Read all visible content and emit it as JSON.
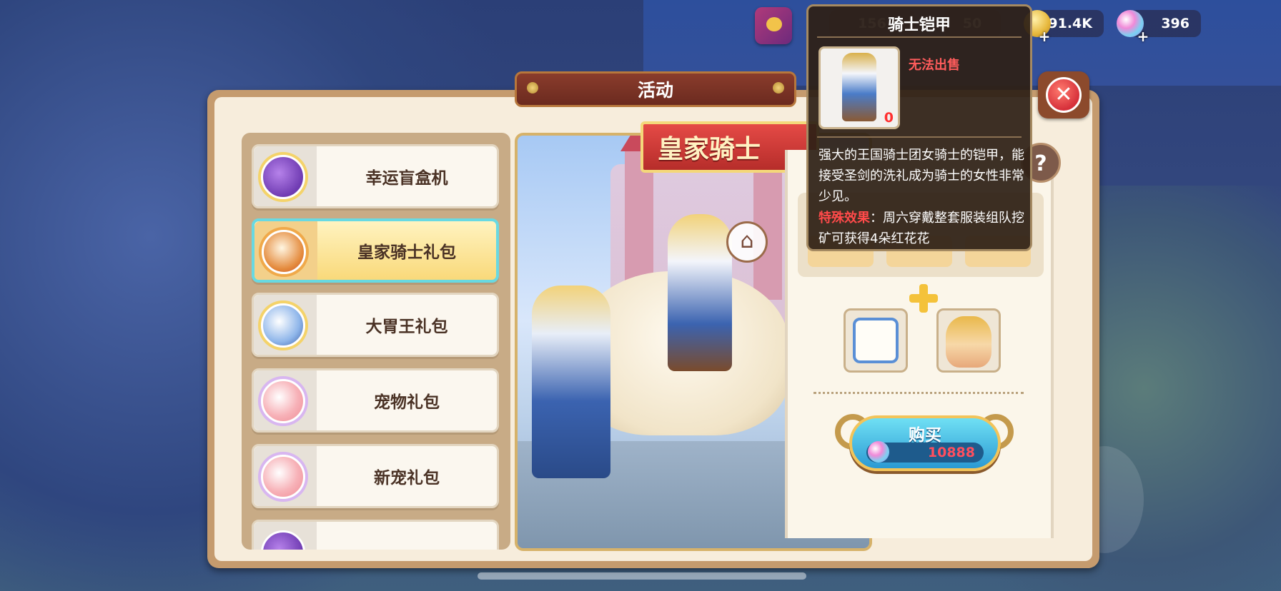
{
  "header": {
    "title": "活动",
    "close_icon": "close-icon"
  },
  "resources": {
    "stat_a": "156",
    "stat_b": "50",
    "gold": "91.4K",
    "gems": "396"
  },
  "menu": {
    "items": [
      {
        "label": "幸运盲盒机",
        "icon": "blindbox-icon",
        "active": false
      },
      {
        "label": "皇家骑士礼包",
        "icon": "horseshoe-icon",
        "active": true
      },
      {
        "label": "大胃王礼包",
        "icon": "penguin-icon",
        "active": false
      },
      {
        "label": "宠物礼包",
        "icon": "paw-icon",
        "active": false
      },
      {
        "label": "新宠礼包",
        "icon": "paw-icon",
        "active": false
      }
    ]
  },
  "banner": {
    "title": "皇家骑士"
  },
  "purchase": {
    "buy_label": "购买",
    "price": "10888"
  },
  "tooltip": {
    "title": "骑士铠甲",
    "status": "无法出售",
    "count": "0",
    "description": "强大的王国骑士团女骑士的铠甲，能接受圣剑的洗礼成为骑士的女性非常少见。",
    "effect_label": "特殊效果",
    "effect_text": "：周六穿戴整套服装组队挖矿可获得4朵红花花"
  },
  "colors": {
    "frame": "#c59b6e",
    "active_item": "#f9d97a",
    "active_border": "#68d9e2",
    "price_text": "#ff4f5e",
    "title_plate": "#7a3226"
  }
}
